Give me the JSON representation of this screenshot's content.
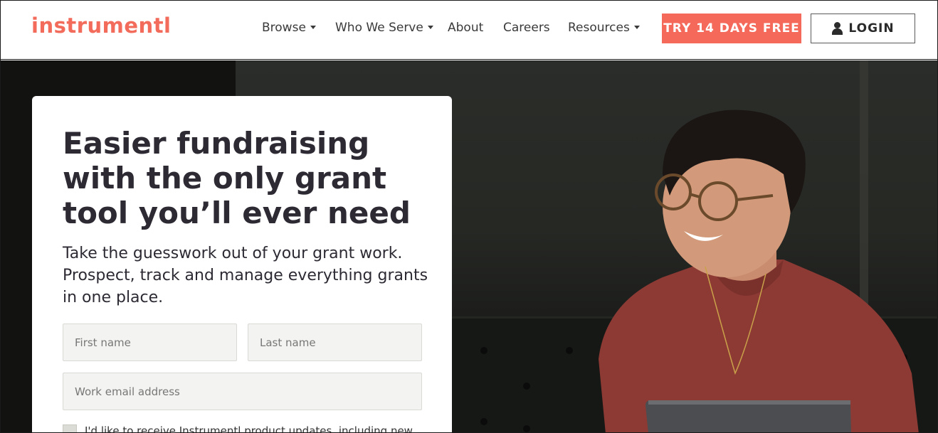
{
  "brand": {
    "logo_text": "instrumentl",
    "accent": "#f4695a",
    "text_dark": "#2d2a33"
  },
  "nav": {
    "items": [
      {
        "label": "Browse",
        "dropdown": true
      },
      {
        "label": "Who We Serve",
        "dropdown": true
      },
      {
        "label": "About",
        "dropdown": false
      },
      {
        "label": "Careers",
        "dropdown": false
      },
      {
        "label": "Resources",
        "dropdown": true
      }
    ]
  },
  "header": {
    "try_label": "TRY 14 DAYS FREE",
    "login_label": "LOGIN",
    "login_icon": "user-icon"
  },
  "hero": {
    "headline": "Easier fundraising with the only grant tool you’ll ever need",
    "subtext": "Take the guesswork out of your grant work. Prospect, track and manage everything grants in one place."
  },
  "form": {
    "first_name_placeholder": "First name",
    "last_name_placeholder": "Last name",
    "email_placeholder": "Work email address",
    "checkbox_label": "I'd like to receive Instrumentl product updates, including new"
  }
}
